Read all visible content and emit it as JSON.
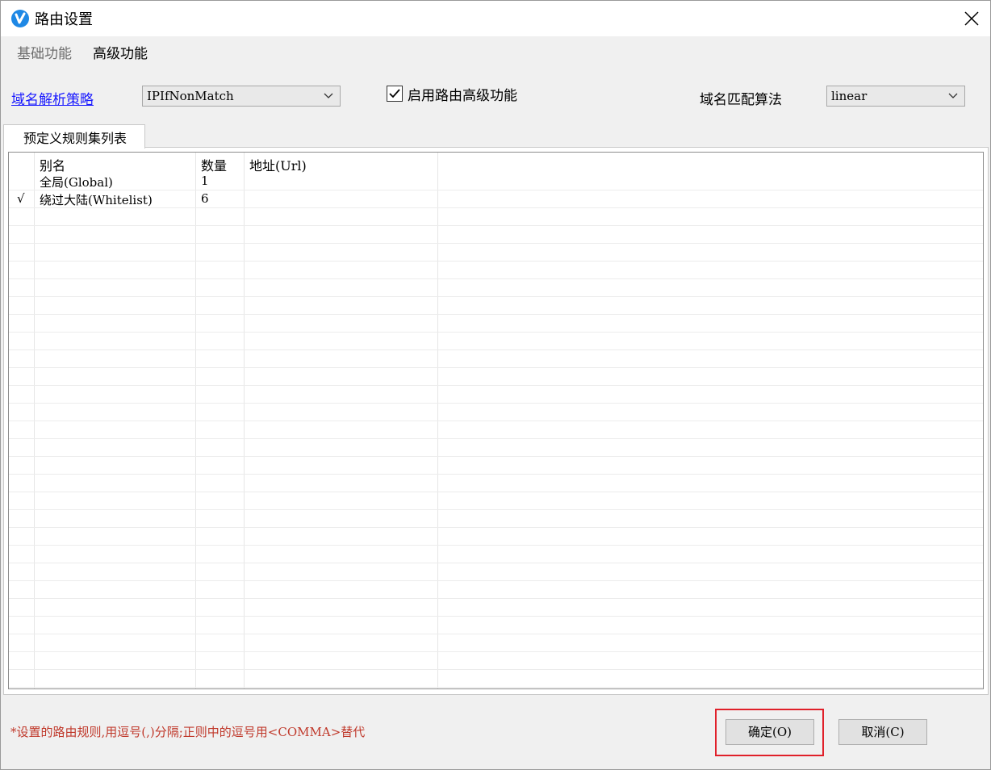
{
  "window": {
    "title": "路由设置"
  },
  "tabs": [
    {
      "label": "基础功能"
    },
    {
      "label": "高级功能"
    }
  ],
  "settings": {
    "policy_link": "域名解析策略",
    "policy_value": "IPIfNonMatch",
    "enable_checkbox_label": "启用路由高级功能",
    "enable_checked": true,
    "algo_label": "域名匹配算法",
    "algo_value": "linear"
  },
  "group": {
    "tab_label": "预定义规则集列表"
  },
  "table": {
    "headers": {
      "alias": "别名",
      "count": "数量",
      "url": "地址(Url)"
    },
    "rows": [
      {
        "check": "",
        "alias": "全局(Global)",
        "count": "1",
        "url": ""
      },
      {
        "check": "√",
        "alias": "绕过大陆(Whitelist)",
        "count": "6",
        "url": ""
      }
    ]
  },
  "footer": {
    "note": "*设置的路由规则,用逗号(,)分隔;正则中的逗号用<COMMA>替代",
    "ok_label": "确定(O)",
    "cancel_label": "取消(C)"
  },
  "colors": {
    "link": "#1a1aff",
    "note": "#c0392b",
    "highlight": "#e0202a",
    "app_icon": "#1e88e5"
  },
  "icons": {
    "app": "v-logo-icon",
    "close": "close-icon",
    "check": "checkmark-icon",
    "dropdown": "chevron-down-icon"
  }
}
